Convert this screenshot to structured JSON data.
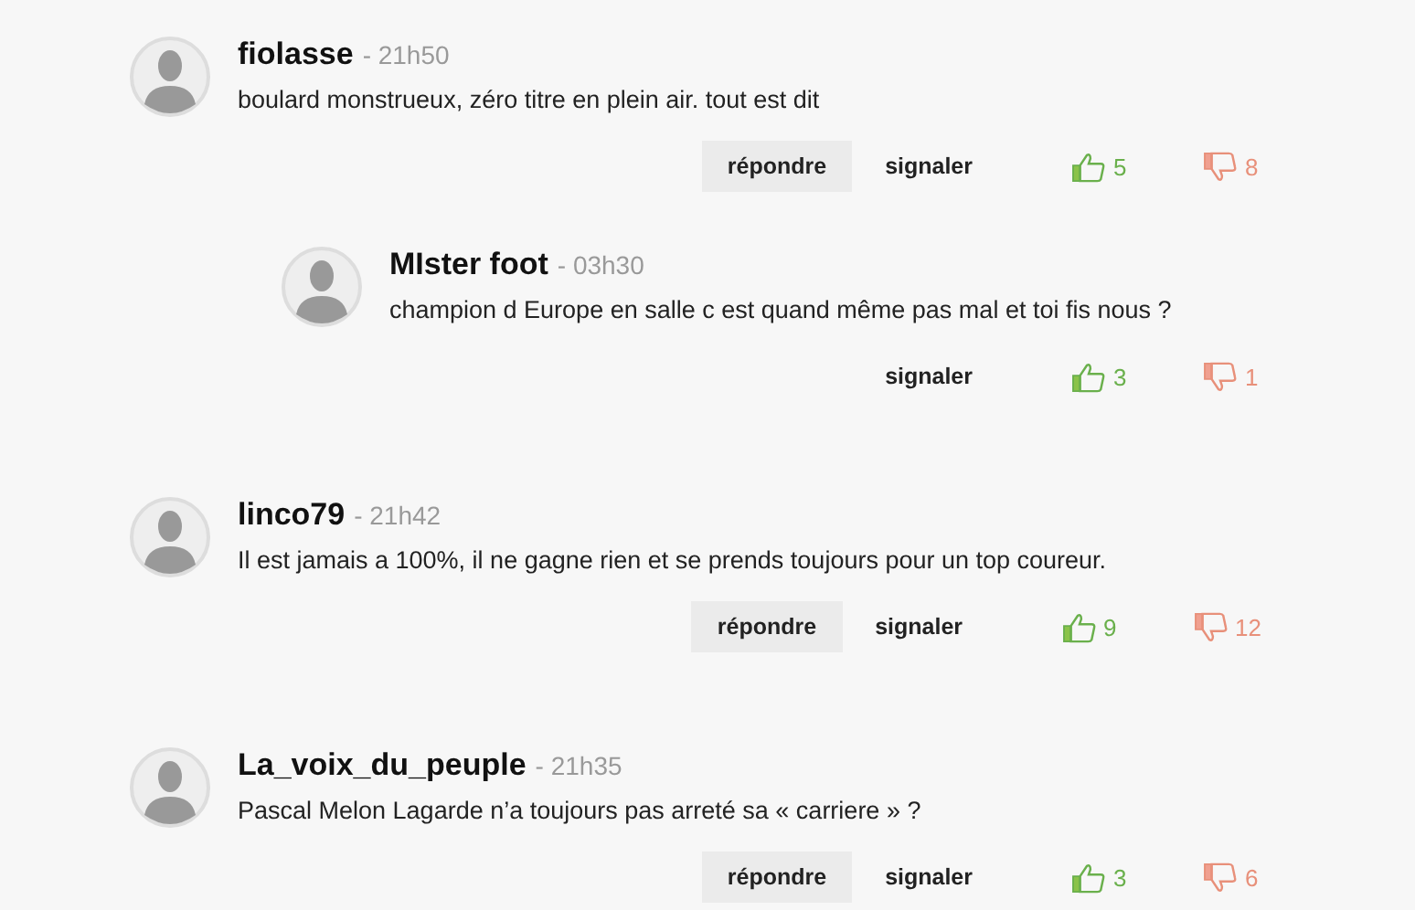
{
  "comments": [
    {
      "author": "fiolasse",
      "time": "- 21h50",
      "text": "boulard monstrueux, zéro titre en plein air. tout est dit",
      "reply_label": "répondre",
      "report_label": "signaler",
      "likes": "5",
      "dislikes": "8",
      "children": [
        {
          "author": "MIster foot",
          "time": "- 03h30",
          "text": "champion d Europe en salle c est quand même pas mal et toi fis nous ?",
          "report_label": "signaler",
          "likes": "3",
          "dislikes": "1"
        }
      ]
    },
    {
      "author": "linco79",
      "time": "- 21h42",
      "text": "Il est jamais a 100%, il ne gagne rien et se prends toujours pour un top coureur.",
      "reply_label": "répondre",
      "report_label": "signaler",
      "likes": "9",
      "dislikes": "12"
    },
    {
      "author": "La_voix_du_peuple",
      "time": "- 21h35",
      "text": "Pascal Melon Lagarde n’a toujours pas arreté sa « carriere » ?",
      "reply_label": "répondre",
      "report_label": "signaler",
      "likes": "3",
      "dislikes": "6"
    }
  ]
}
